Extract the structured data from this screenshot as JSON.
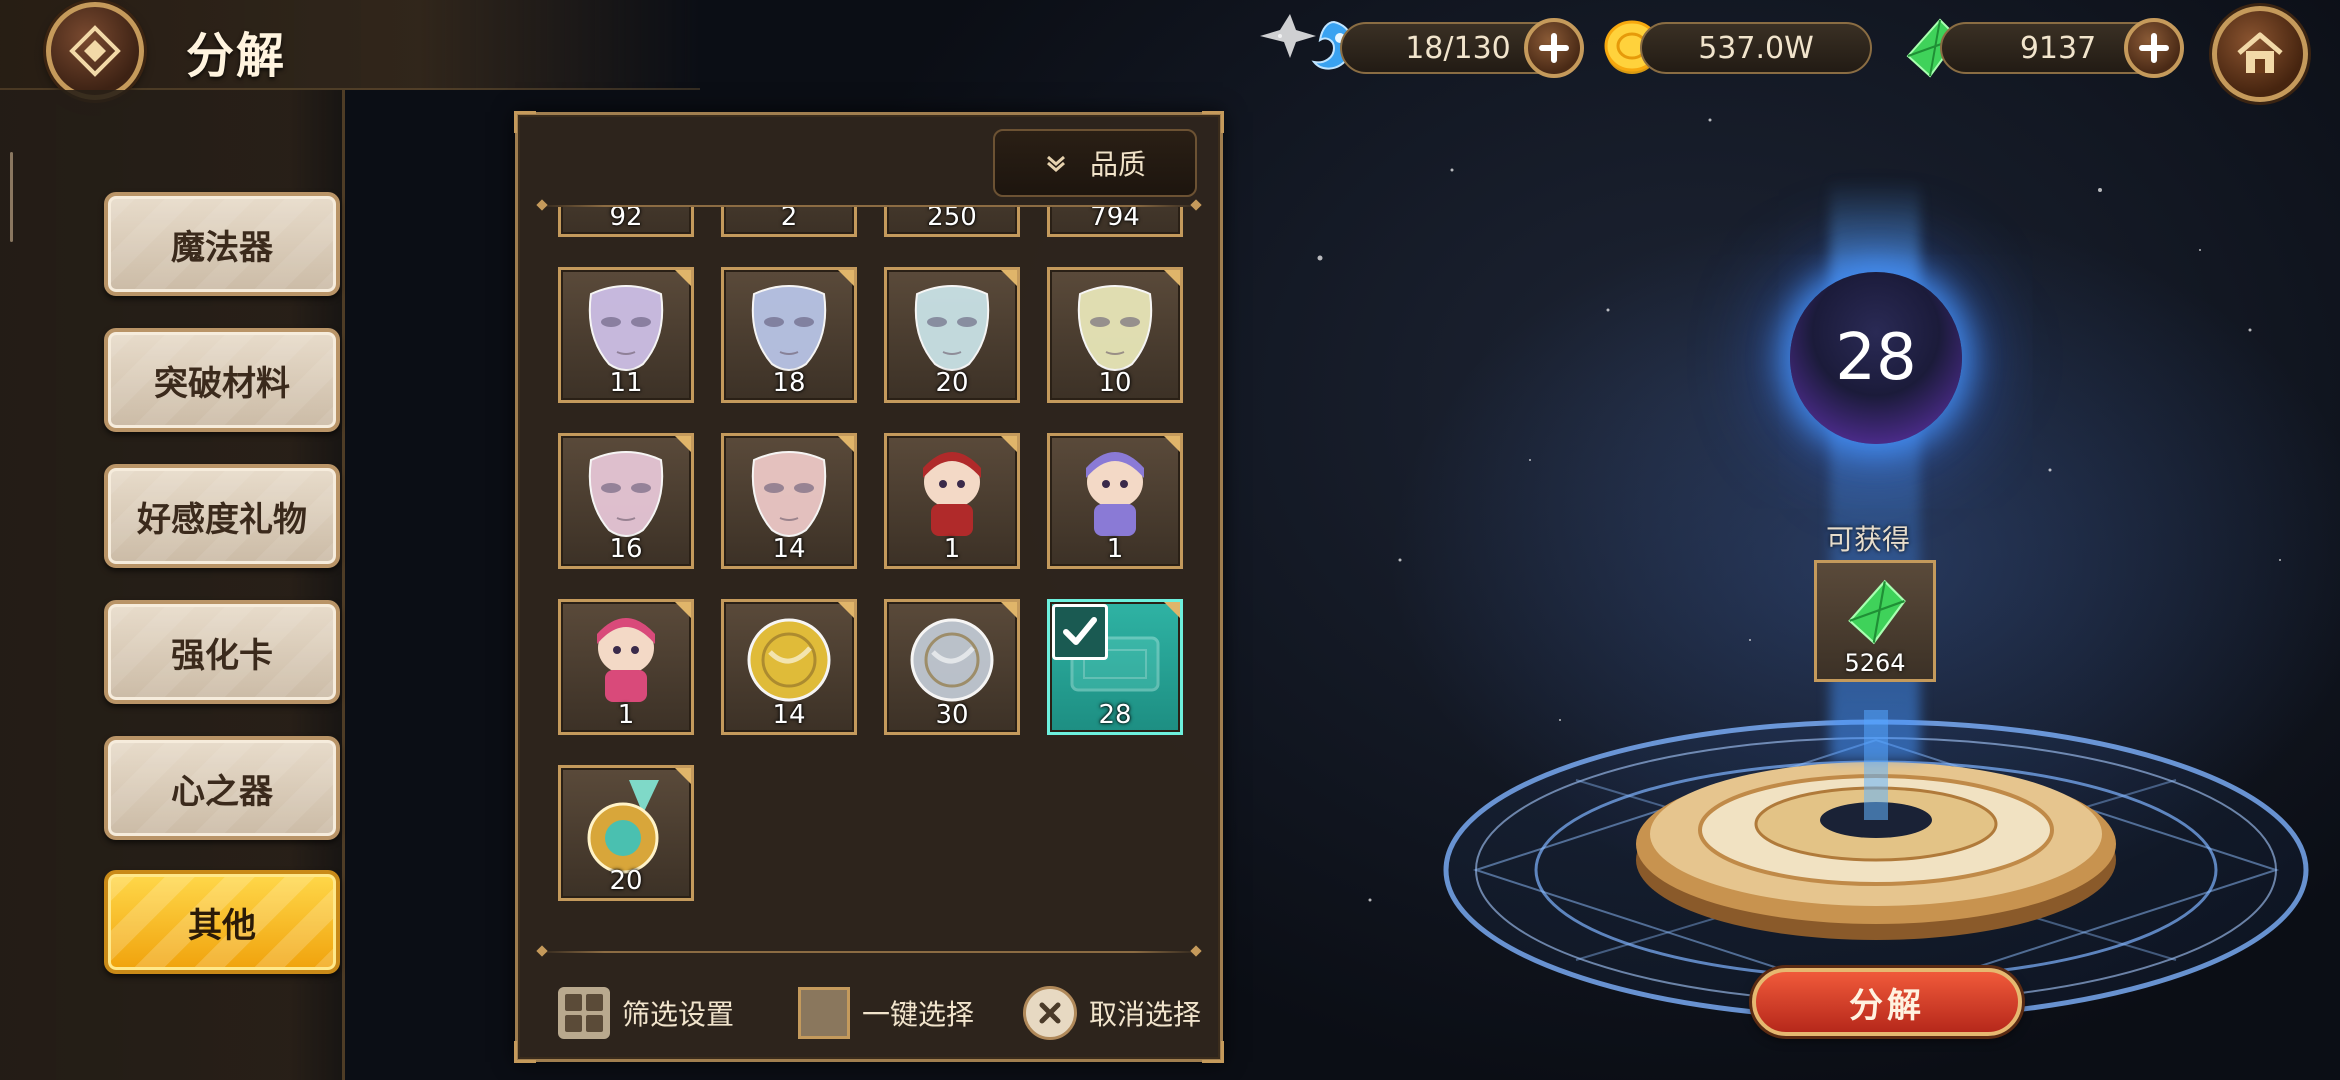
{
  "header": {
    "title": "分解"
  },
  "resources": {
    "stamina": {
      "value": "18/130",
      "icon": "blue-gem-swirl-icon"
    },
    "gold": {
      "value": "537.0W",
      "icon": "gold-coin-icon"
    },
    "crystal": {
      "value": "9137",
      "icon": "green-crystal-icon"
    }
  },
  "sidebar": {
    "items": [
      {
        "label": "魔法器",
        "active": false
      },
      {
        "label": "突破材料",
        "active": false
      },
      {
        "label": "好感度礼物",
        "active": false
      },
      {
        "label": "强化卡",
        "active": false
      },
      {
        "label": "心之器",
        "active": false
      },
      {
        "label": "其他",
        "active": true
      }
    ]
  },
  "panel": {
    "filter_label": "品质",
    "partial_row": [
      "92",
      "2",
      "250",
      "794"
    ],
    "items": [
      {
        "name": "lavender-mask",
        "count": "11",
        "color": "#cdbfe6"
      },
      {
        "name": "blue-mask",
        "count": "18",
        "color": "#b8c4e6"
      },
      {
        "name": "cyan-mask",
        "count": "20",
        "color": "#c9e2e6"
      },
      {
        "name": "gold-mask",
        "count": "10",
        "color": "#e8e6b8"
      },
      {
        "name": "pink-mask",
        "count": "16",
        "color": "#e6c6d6"
      },
      {
        "name": "rose-mask",
        "count": "14",
        "color": "#ecc8c6"
      },
      {
        "name": "witch-chibi-figure",
        "count": "1",
        "color": "#b02a2a"
      },
      {
        "name": "silver-hair-chibi-figure",
        "count": "1",
        "color": "#8a7ad6"
      },
      {
        "name": "blonde-chibi-figure",
        "count": "1",
        "color": "#d94a7a"
      },
      {
        "name": "gold-coin-token",
        "count": "14",
        "color": "#e8c23a"
      },
      {
        "name": "silver-coin-token",
        "count": "30",
        "color": "#c0c8d2"
      },
      {
        "name": "enhance-ticket",
        "count": "28",
        "color": "#5ad0c0",
        "selected": true
      },
      {
        "name": "gold-medal",
        "count": "20",
        "color": "#d8a63a"
      }
    ],
    "actions": {
      "filter_settings": "筛选设置",
      "select_all": "一键选择",
      "cancel_select": "取消选择"
    }
  },
  "result": {
    "orb_value": "28",
    "obtain_label": "可获得",
    "reward": {
      "icon": "green-crystal-icon",
      "count": "5264"
    },
    "decompose_label": "分解"
  },
  "colors": {
    "accent_gold": "#c59a5b",
    "active_tab": "#f0a20c",
    "selected_slot": "#2fb3a4",
    "crystal_green": "#3fd25a"
  }
}
